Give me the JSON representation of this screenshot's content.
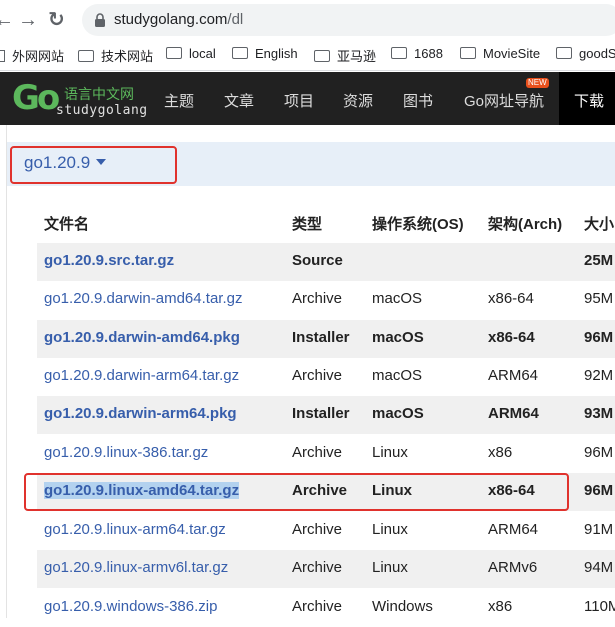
{
  "browser": {
    "url_host": "studygolang.com",
    "url_path": "/dl",
    "bookmarks": [
      "外网网站",
      "技术网站",
      "local",
      "English",
      "亚马逊",
      "1688",
      "MovieSite",
      "goodS"
    ]
  },
  "site": {
    "logo_cn": "语言中文网",
    "logo_en": "studygolang",
    "menu": [
      "主题",
      "文章",
      "项目",
      "资源",
      "图书",
      "Go网址导航",
      "下载"
    ],
    "new_badge": "NEW"
  },
  "download": {
    "version": "go1.20.9",
    "headers": [
      "文件名",
      "类型",
      "操作系统(OS)",
      "架构(Arch)",
      "大小"
    ],
    "rows": [
      {
        "name": "go1.20.9.src.tar.gz",
        "kind": "Source",
        "os": "",
        "arch": "",
        "size": "25M"
      },
      {
        "name": "go1.20.9.darwin-amd64.tar.gz",
        "kind": "Archive",
        "os": "macOS",
        "arch": "x86-64",
        "size": "95M"
      },
      {
        "name": "go1.20.9.darwin-amd64.pkg",
        "kind": "Installer",
        "os": "macOS",
        "arch": "x86-64",
        "size": "96M"
      },
      {
        "name": "go1.20.9.darwin-arm64.tar.gz",
        "kind": "Archive",
        "os": "macOS",
        "arch": "ARM64",
        "size": "92M"
      },
      {
        "name": "go1.20.9.darwin-arm64.pkg",
        "kind": "Installer",
        "os": "macOS",
        "arch": "ARM64",
        "size": "93M"
      },
      {
        "name": "go1.20.9.linux-386.tar.gz",
        "kind": "Archive",
        "os": "Linux",
        "arch": "x86",
        "size": "96M"
      },
      {
        "name": "go1.20.9.linux-amd64.tar.gz",
        "kind": "Archive",
        "os": "Linux",
        "arch": "x86-64",
        "size": "96M"
      },
      {
        "name": "go1.20.9.linux-arm64.tar.gz",
        "kind": "Archive",
        "os": "Linux",
        "arch": "ARM64",
        "size": "91M"
      },
      {
        "name": "go1.20.9.linux-armv6l.tar.gz",
        "kind": "Archive",
        "os": "Linux",
        "arch": "ARMv6",
        "size": "94M"
      },
      {
        "name": "go1.20.9.windows-386.zip",
        "kind": "Archive",
        "os": "Windows",
        "arch": "x86",
        "size": "110M"
      }
    ]
  }
}
